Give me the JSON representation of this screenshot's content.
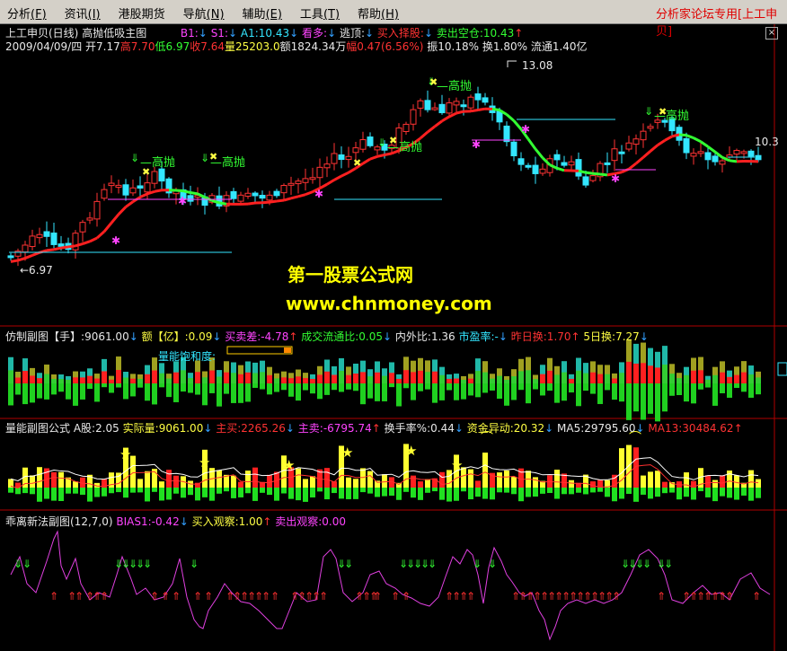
{
  "menu": {
    "items": [
      {
        "label": "分析",
        "mnemonic": "F"
      },
      {
        "label": "资讯",
        "mnemonic": "I"
      },
      {
        "label": "港股期货",
        "mnemonic": ""
      },
      {
        "label": "导航",
        "mnemonic": "N"
      },
      {
        "label": "辅助",
        "mnemonic": "E"
      },
      {
        "label": "工具",
        "mnemonic": "T"
      },
      {
        "label": "帮助",
        "mnemonic": "H"
      }
    ],
    "forum_label": "分析家论坛专用",
    "stock_box": "[上工申贝]"
  },
  "main_panel": {
    "title": "上工申贝(日线)",
    "indicator": "高抛低吸主图",
    "b1_label": "B1:",
    "s1_label": "S1:",
    "a1": "A1:10.43",
    "kanduo": "看多:",
    "taoxian": "逃顶:",
    "mairu": "买入择股:",
    "maichu": "卖出空仓:10.43",
    "date": "2009/04/09/四",
    "open": "开7.17",
    "high": "高7.70",
    "low": "低6.97",
    "close": "收7.64",
    "volume": "量25203.0",
    "amount": "额1824.34万",
    "change": "幅0.47(6.56%)",
    "amplitude": "振10.18%",
    "turnover": "换1.80%",
    "float": "流通1.40亿",
    "low_marker": "6.97",
    "high_marker": "13.08",
    "last_price": "10.3",
    "gaopao_label": "高抛"
  },
  "watermark": {
    "line1": "第一股票公式网",
    "line2": "www.chnmoney.com"
  },
  "vol_panel": {
    "name": "仿制副图",
    "unit1": "【手】",
    "vol": ":9061.00",
    "amt_label": "额【亿】",
    "amt": ":0.09",
    "buysell_diff": "买卖差:-4.78",
    "vol_ratio": "成交流通比:0.05",
    "inout": "内外比:1.36",
    "pe": "市盈率:-",
    "prev_turn": "昨日换:1.70",
    "five_day": "5日换:7.27",
    "saturation_label": "量能饱和度:"
  },
  "energy_panel": {
    "name": "量能副图公式",
    "ashare": "A股:2.05",
    "actual": "实际量:9061.00",
    "main_buy": "主买:2265.26",
    "main_sell": "主卖:-6795.74",
    "turn_rate": "换手率%:0.44",
    "capital": "资金异动:20.32",
    "ma5": "MA5:29795.60",
    "ma13": "MA13:30484.62"
  },
  "bias_panel": {
    "name": "乖离新法副图(12,7,0)",
    "bias": "BIAS1:-0.42",
    "buy_watch": "买入观察:1.00",
    "sell_watch": "卖出观察:0.00"
  },
  "colors": {
    "up": "#ff3333",
    "down": "#33e6ff",
    "ma_up": "#ff2020",
    "ma_down": "#33ff33",
    "magenta": "#ff44ff",
    "yellow": "#ffff44"
  }
}
